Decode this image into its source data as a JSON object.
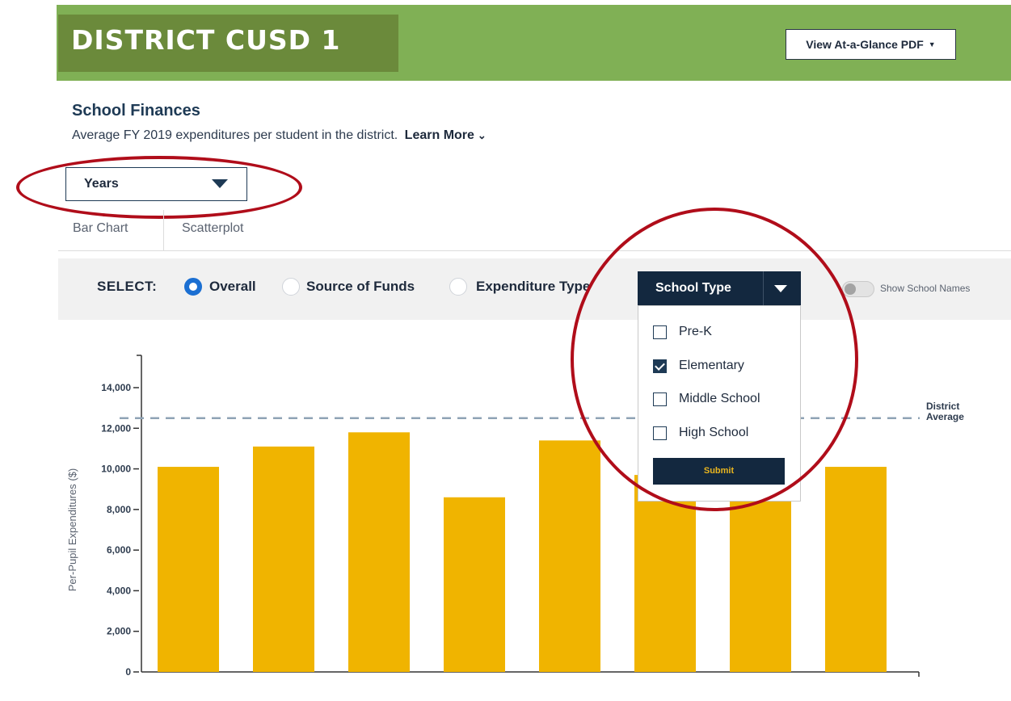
{
  "header": {
    "title": "DISTRICT CUSD 1",
    "pdf_button": "View At-a-Glance PDF"
  },
  "section": {
    "title": "School Finances",
    "subtitle": "Average FY 2019 expenditures per student in the district.",
    "learn_more": "Learn More"
  },
  "years_select": {
    "value": "Years"
  },
  "tabs": [
    "Bar Chart",
    "Scatterplot"
  ],
  "select_bar": {
    "label": "SELECT:",
    "options": [
      {
        "label": "Overall",
        "checked": true
      },
      {
        "label": "Source of Funds",
        "checked": false
      },
      {
        "label": "Expenditure Type",
        "checked": false
      }
    ],
    "school_type": "School Type",
    "show_names": "Show School Names"
  },
  "school_type_menu": {
    "options": [
      {
        "label": "Pre-K",
        "checked": false
      },
      {
        "label": "Elementary",
        "checked": true
      },
      {
        "label": "Middle School",
        "checked": false
      },
      {
        "label": "High School",
        "checked": false
      }
    ],
    "submit": "Submit"
  },
  "colors": {
    "header_green": "#80b055",
    "title_green": "#6b8a3b",
    "bar": "#f0b400",
    "navy": "#13283f",
    "annotation_red": "#b00d1a"
  },
  "chart_data": {
    "type": "bar",
    "ylabel": "Per-Pupil Expenditures ($)",
    "ylim": [
      0,
      15000
    ],
    "yticks": [
      "0",
      "2,000",
      "4,000",
      "6,000",
      "8,000",
      "10,000",
      "12,000",
      "14,000"
    ],
    "values": [
      10100,
      11100,
      11800,
      8600,
      11400,
      9700,
      9700,
      10100
    ],
    "reference_line": {
      "value": 12500,
      "label": [
        "District",
        "Average"
      ]
    }
  }
}
